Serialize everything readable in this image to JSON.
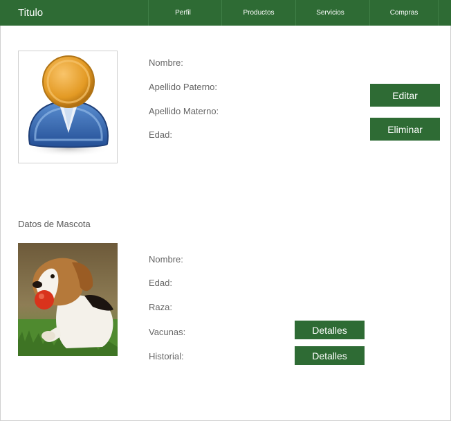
{
  "header": {
    "title": "Titulo",
    "nav": [
      {
        "label": "Perfil"
      },
      {
        "label": "Productos"
      },
      {
        "label": "Servicios"
      },
      {
        "label": "Compras"
      }
    ]
  },
  "owner": {
    "fields": [
      {
        "label": "Nombre:"
      },
      {
        "label": "Apellido Paterno:"
      },
      {
        "label": "Apellido Materno:"
      },
      {
        "label": "Edad:"
      }
    ],
    "edit_label": "Editar",
    "delete_label": "Eliminar"
  },
  "pet": {
    "section_title": "Datos de Mascota",
    "fields": [
      {
        "label": "Nombre:"
      },
      {
        "label": "Edad:"
      },
      {
        "label": "Raza:"
      },
      {
        "label": "Vacunas:"
      },
      {
        "label": "Historial:"
      }
    ],
    "details_label": "Detalles"
  },
  "colors": {
    "accent": "#2e6b34",
    "text": "#666666"
  },
  "icons": {
    "owner_avatar": "user-avatar-icon",
    "pet_photo": "dog-photo"
  }
}
